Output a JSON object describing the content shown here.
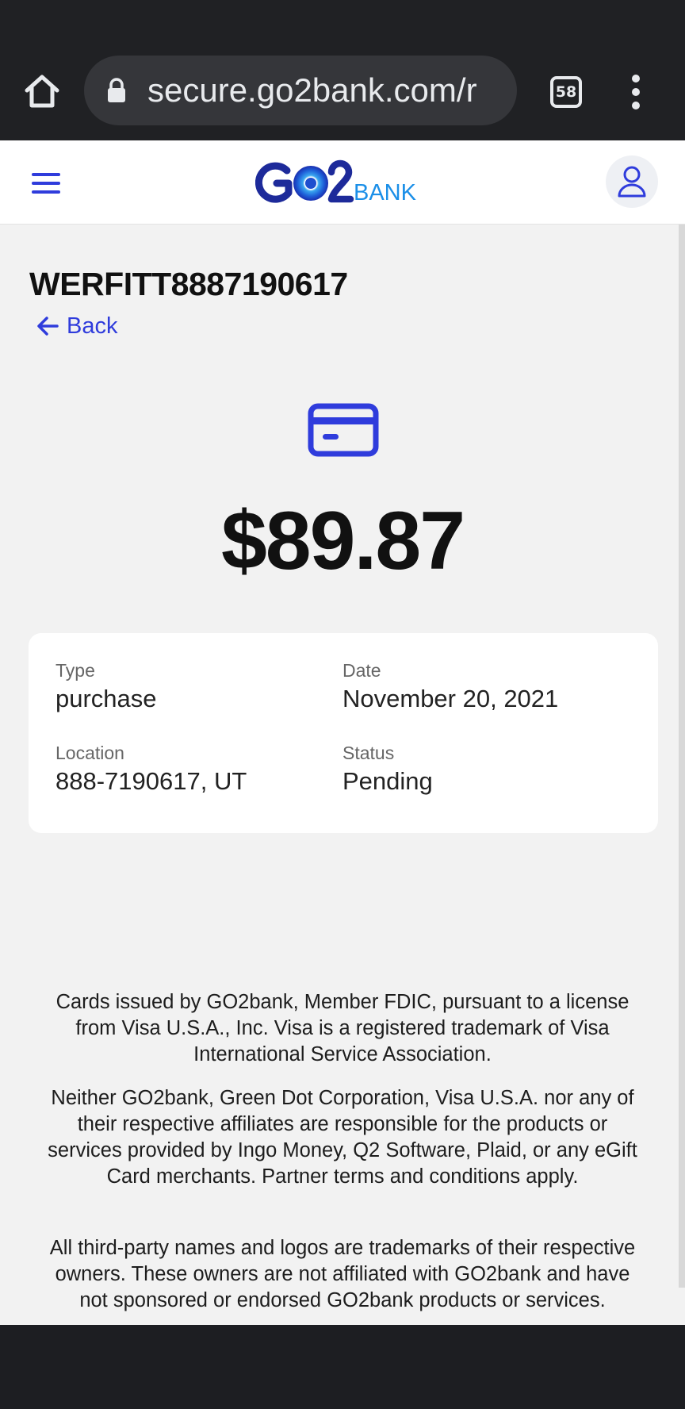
{
  "browser": {
    "url": "secure.go2bank.com/r",
    "tab_count": "58"
  },
  "header": {
    "logo_text_primary": "GO2",
    "logo_text_secondary": "BANK",
    "brand_color": "#2f3cdc"
  },
  "transaction": {
    "title": "WERFITT8887190617",
    "back_label": "Back",
    "amount": "$89.87",
    "fields": {
      "type_label": "Type",
      "type_value": "purchase",
      "date_label": "Date",
      "date_value": "November 20, 2021",
      "location_label": "Location",
      "location_value": "888-7190617, UT",
      "status_label": "Status",
      "status_value": "Pending"
    }
  },
  "footer": {
    "disclaimer_1": "Cards issued by GO2bank, Member FDIC, pursuant to a license from Visa U.S.A., Inc. Visa is a registered trademark of Visa International Service Association.",
    "disclaimer_2": "Neither GO2bank, Green Dot Corporation, Visa U.S.A. nor any of their respective affiliates are responsible for the products or services provided by Ingo Money, Q2 Software, Plaid, or any eGift Card merchants. Partner terms and conditions apply.",
    "disclaimer_3": "All third-party names and logos are trademarks of their respective owners. These owners are not affiliated with GO2bank and have not sponsored or endorsed GO2bank products or services."
  }
}
